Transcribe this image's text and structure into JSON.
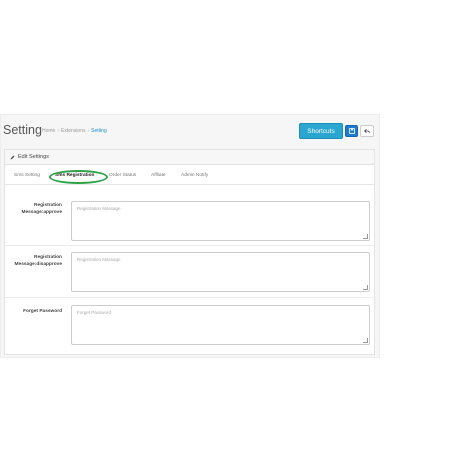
{
  "header": {
    "title": "Setting",
    "breadcrumb": [
      "Home",
      "Extensions",
      "Setting"
    ],
    "shortcuts_label": "Shortcuts"
  },
  "panel": {
    "heading": "Edit Settings",
    "tabs": [
      {
        "label": "Sms Setting",
        "active": false
      },
      {
        "label": "Sms Registration",
        "active": true
      },
      {
        "label": "Order Status",
        "active": false
      },
      {
        "label": "Affliate",
        "active": false
      },
      {
        "label": "Admin Notify",
        "active": false
      }
    ],
    "fields": [
      {
        "label_line1": "Registration",
        "label_line2": "Message:approve",
        "placeholder": "Registration Massage"
      },
      {
        "label_line1": "Registration",
        "label_line2": "Message:disapprove",
        "placeholder": "Registration Massage"
      },
      {
        "label_line1": "Forget Password",
        "label_line2": "",
        "placeholder": "Forget Password"
      }
    ]
  },
  "colors": {
    "shortcuts_button": "#2aa6d0",
    "save_button": "#1e7bd0",
    "active_tab_highlight": "#2fa34a",
    "breadcrumb_current": "#1e91cf"
  },
  "icons": {
    "edit": "pencil-icon",
    "save": "save-icon",
    "back": "reply-icon"
  }
}
